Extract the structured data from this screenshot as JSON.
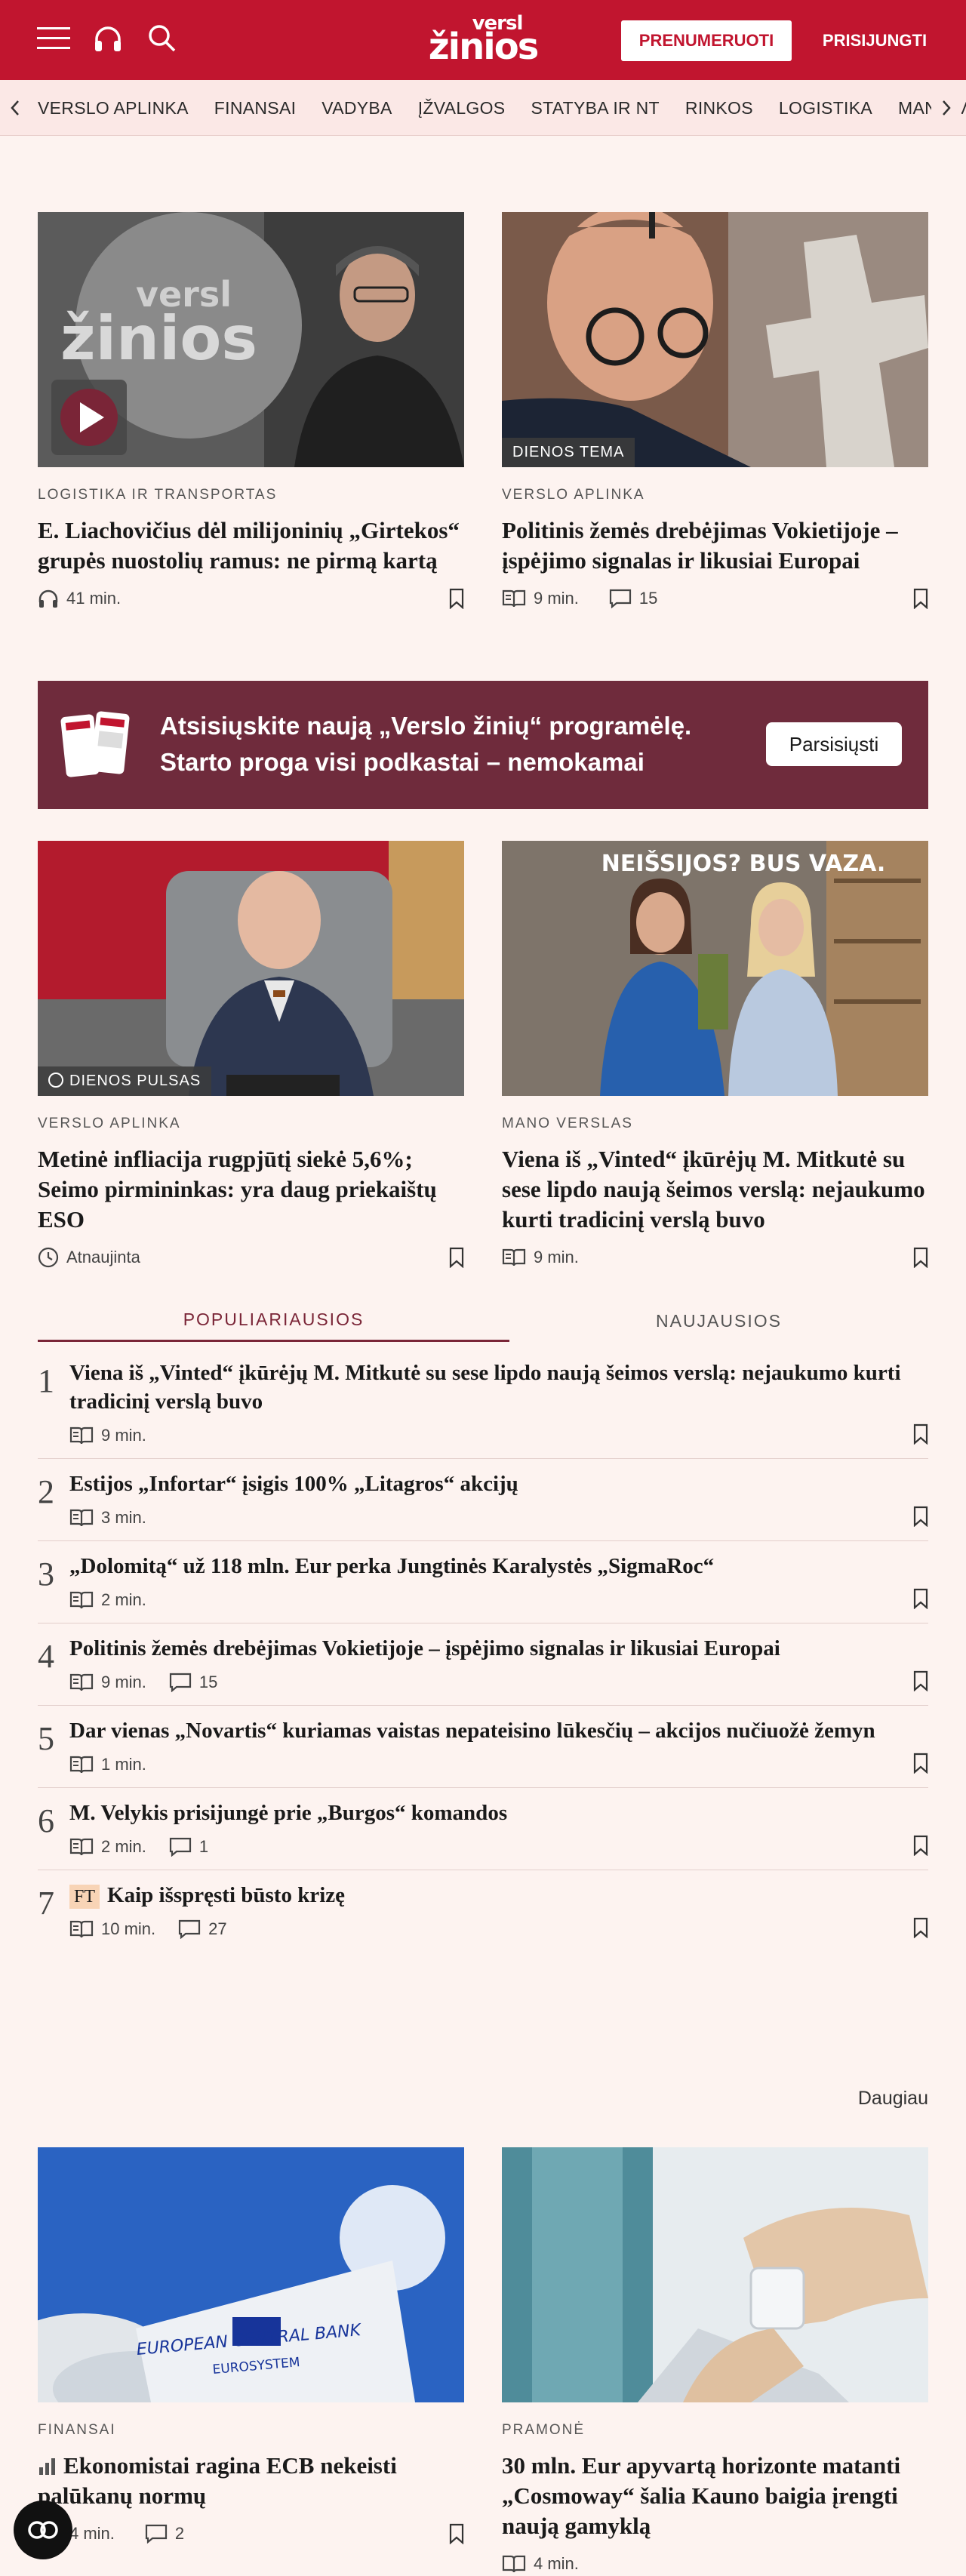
{
  "header": {
    "subscribe_label": "PRENUMERUOTI",
    "login_label": "PRISIJUNGTI",
    "logo_line1": "versl",
    "logo_line2": "žinios",
    "bg_color": "#c1152f"
  },
  "nav": {
    "items": [
      "VERSLO APLINKA",
      "FINANSAI",
      "VADYBA",
      "ĮŽVALGOS",
      "STATYBA IR NT",
      "RINKOS",
      "LOGISTIKA",
      "MANO VERSLAS"
    ]
  },
  "articles_top": [
    {
      "category": "LOGISTIKA IR TRANSPORTAS",
      "title": "E. Liachovičius dėl milijoninių „Girtekos“ grupės nuostolių ramus: ne pirmą kartą",
      "read": "41 min.",
      "icon": "headphones-icon"
    },
    {
      "category": "VERSLO APLINKA",
      "title": "Politinis žemės drebėjimas Vokietijoje – įspėjimo signalas ir likusiai Europai",
      "read": "9 min.",
      "comments": "15",
      "badge": "DIENOS TEMA",
      "icon": "book-icon"
    }
  ],
  "banner": {
    "text_line1": "Atsisiųskite naują „Verslo žinių“ programėlę.",
    "text_line2": "Starto proga visi podkastai – nemokamai",
    "button_label": "Parsisiųsti",
    "bg_color": "#6f2b3c"
  },
  "articles_mid": [
    {
      "category": "VERSLO APLINKA",
      "title": "Metinė infliacija rugpjūtį siekė 5,6%; Seimo pirmininkas: yra daug priekaištų ESO",
      "status": "Atnaujinta",
      "badge": "DIENOS PULSAS",
      "icon": "clock-icon"
    },
    {
      "category": "MANO VERSLAS",
      "title": "Viena iš „Vinted“ įkūrėjų M. Mitkutė su sese lipdo naują šeimos verslą: nejaukumo kurti tradicinį verslą buvo",
      "read": "9 min.",
      "icon": "book-icon",
      "sign_text": "NEIŠSIJOS? BUS VAZA."
    }
  ],
  "tabs": {
    "popular": "POPULIARIAUSIOS",
    "latest": "NAUJAUSIOS"
  },
  "popular": [
    {
      "num": "1",
      "title": "Viena iš „Vinted“ įkūrėjų M. Mitkutė su sese lipdo naują šeimos verslą: nejaukumo kurti tradicinį verslą buvo",
      "read": "9 min."
    },
    {
      "num": "2",
      "title": "Estijos „Infortar“ įsigis 100% „Litagros“ akcijų",
      "read": "3 min."
    },
    {
      "num": "3",
      "title": "„Dolomitą“ už 118 mln. Eur perka Jungtinės Karalystės „SigmaRoc“",
      "read": "2 min."
    },
    {
      "num": "4",
      "title": "Politinis žemės drebėjimas Vokietijoje – įspėjimo signalas ir likusiai Europai",
      "read": "9 min.",
      "comments": "15"
    },
    {
      "num": "5",
      "title": "Dar vienas „Novartis“ kuriamas vaistas nepateisino lūkesčių – akcijos nučiuožė žemyn",
      "read": "1 min."
    },
    {
      "num": "6",
      "title": "M. Velykis prisijungė prie „Burgos“ komandos",
      "read": "2 min.",
      "comments": "1"
    },
    {
      "num": "7",
      "title": "Kaip išspręsti būsto krizę",
      "read": "10 min.",
      "comments": "27",
      "ft": "FT"
    }
  ],
  "more_label": "Daugiau",
  "articles_bottom": [
    {
      "category": "FINANSAI",
      "title": "Ekonomistai ragina ECB nekeisti palūkanų normų",
      "read": "4 min.",
      "comments": "2",
      "ecb_line1": "EUROPEAN CENTRAL BANK",
      "ecb_line2": "EUROSYSTEM"
    },
    {
      "category": "PRAMONĖ",
      "title": "30 mln. Eur apyvartą horizonte matanti „Cosmoway“ šalia Kauno baigia įrengti naują gamyklą",
      "read": "4 min."
    }
  ]
}
